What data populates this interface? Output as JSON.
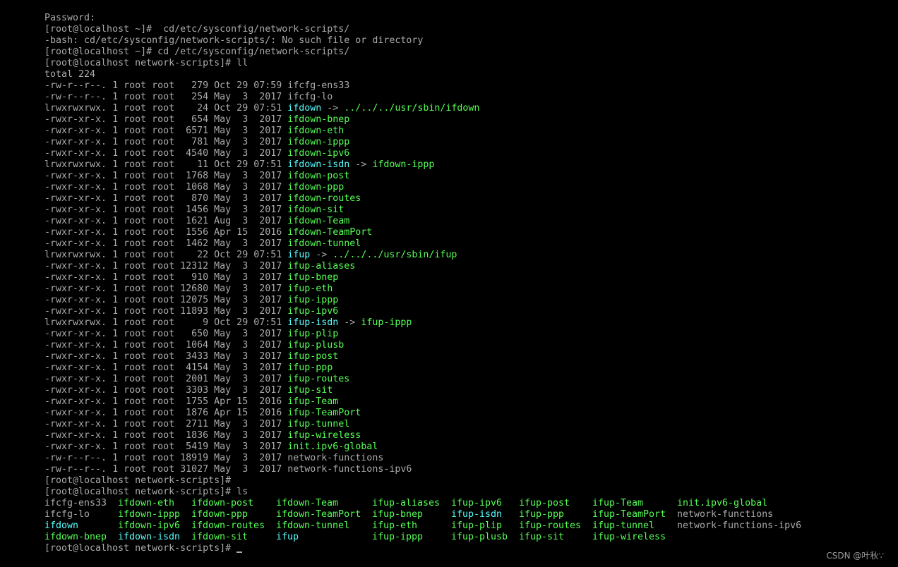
{
  "colors": {
    "background": "#000000",
    "plain": "#aaaaaa",
    "exec": "#55ff55",
    "link": "#55ffff"
  },
  "preamble": [
    "Password:",
    "[root@localhost ~]#  cd/etc/sysconfig/network-scripts/",
    "-bash: cd/etc/sysconfig/network-scripts/: No such file or directory",
    "[root@localhost ~]# cd /etc/sysconfig/network-scripts/",
    "[root@localhost network-scripts]# ll",
    "total 224"
  ],
  "ll_rows": [
    {
      "meta": "-rw-r--r--. 1 root root   279 Oct 29 07:59 ",
      "name": "ifcfg-ens33",
      "kind": "plain"
    },
    {
      "meta": "-rw-r--r--. 1 root root   254 May  3  2017 ",
      "name": "ifcfg-lo",
      "kind": "plain"
    },
    {
      "meta": "lrwxrwxrwx. 1 root root    24 Oct 29 07:51 ",
      "name": "ifdown",
      "kind": "link",
      "target": "../../../usr/sbin/ifdown"
    },
    {
      "meta": "-rwxr-xr-x. 1 root root   654 May  3  2017 ",
      "name": "ifdown-bnep",
      "kind": "exec"
    },
    {
      "meta": "-rwxr-xr-x. 1 root root  6571 May  3  2017 ",
      "name": "ifdown-eth",
      "kind": "exec"
    },
    {
      "meta": "-rwxr-xr-x. 1 root root   781 May  3  2017 ",
      "name": "ifdown-ippp",
      "kind": "exec"
    },
    {
      "meta": "-rwxr-xr-x. 1 root root  4540 May  3  2017 ",
      "name": "ifdown-ipv6",
      "kind": "exec"
    },
    {
      "meta": "lrwxrwxrwx. 1 root root    11 Oct 29 07:51 ",
      "name": "ifdown-isdn",
      "kind": "link",
      "target": "ifdown-ippp"
    },
    {
      "meta": "-rwxr-xr-x. 1 root root  1768 May  3  2017 ",
      "name": "ifdown-post",
      "kind": "exec"
    },
    {
      "meta": "-rwxr-xr-x. 1 root root  1068 May  3  2017 ",
      "name": "ifdown-ppp",
      "kind": "exec"
    },
    {
      "meta": "-rwxr-xr-x. 1 root root   870 May  3  2017 ",
      "name": "ifdown-routes",
      "kind": "exec"
    },
    {
      "meta": "-rwxr-xr-x. 1 root root  1456 May  3  2017 ",
      "name": "ifdown-sit",
      "kind": "exec"
    },
    {
      "meta": "-rwxr-xr-x. 1 root root  1621 Aug  3  2017 ",
      "name": "ifdown-Team",
      "kind": "exec"
    },
    {
      "meta": "-rwxr-xr-x. 1 root root  1556 Apr 15  2016 ",
      "name": "ifdown-TeamPort",
      "kind": "exec"
    },
    {
      "meta": "-rwxr-xr-x. 1 root root  1462 May  3  2017 ",
      "name": "ifdown-tunnel",
      "kind": "exec"
    },
    {
      "meta": "lrwxrwxrwx. 1 root root    22 Oct 29 07:51 ",
      "name": "ifup",
      "kind": "link",
      "target": "../../../usr/sbin/ifup"
    },
    {
      "meta": "-rwxr-xr-x. 1 root root 12312 May  3  2017 ",
      "name": "ifup-aliases",
      "kind": "exec"
    },
    {
      "meta": "-rwxr-xr-x. 1 root root   910 May  3  2017 ",
      "name": "ifup-bnep",
      "kind": "exec"
    },
    {
      "meta": "-rwxr-xr-x. 1 root root 12680 May  3  2017 ",
      "name": "ifup-eth",
      "kind": "exec"
    },
    {
      "meta": "-rwxr-xr-x. 1 root root 12075 May  3  2017 ",
      "name": "ifup-ippp",
      "kind": "exec"
    },
    {
      "meta": "-rwxr-xr-x. 1 root root 11893 May  3  2017 ",
      "name": "ifup-ipv6",
      "kind": "exec"
    },
    {
      "meta": "lrwxrwxrwx. 1 root root     9 Oct 29 07:51 ",
      "name": "ifup-isdn",
      "kind": "link",
      "target": "ifup-ippp"
    },
    {
      "meta": "-rwxr-xr-x. 1 root root   650 May  3  2017 ",
      "name": "ifup-plip",
      "kind": "exec"
    },
    {
      "meta": "-rwxr-xr-x. 1 root root  1064 May  3  2017 ",
      "name": "ifup-plusb",
      "kind": "exec"
    },
    {
      "meta": "-rwxr-xr-x. 1 root root  3433 May  3  2017 ",
      "name": "ifup-post",
      "kind": "exec"
    },
    {
      "meta": "-rwxr-xr-x. 1 root root  4154 May  3  2017 ",
      "name": "ifup-ppp",
      "kind": "exec"
    },
    {
      "meta": "-rwxr-xr-x. 1 root root  2001 May  3  2017 ",
      "name": "ifup-routes",
      "kind": "exec"
    },
    {
      "meta": "-rwxr-xr-x. 1 root root  3303 May  3  2017 ",
      "name": "ifup-sit",
      "kind": "exec"
    },
    {
      "meta": "-rwxr-xr-x. 1 root root  1755 Apr 15  2016 ",
      "name": "ifup-Team",
      "kind": "exec"
    },
    {
      "meta": "-rwxr-xr-x. 1 root root  1876 Apr 15  2016 ",
      "name": "ifup-TeamPort",
      "kind": "exec"
    },
    {
      "meta": "-rwxr-xr-x. 1 root root  2711 May  3  2017 ",
      "name": "ifup-tunnel",
      "kind": "exec"
    },
    {
      "meta": "-rwxr-xr-x. 1 root root  1836 May  3  2017 ",
      "name": "ifup-wireless",
      "kind": "exec"
    },
    {
      "meta": "-rwxr-xr-x. 1 root root  5419 May  3  2017 ",
      "name": "init.ipv6-global",
      "kind": "exec"
    },
    {
      "meta": "-rw-r--r--. 1 root root 18919 May  3  2017 ",
      "name": "network-functions",
      "kind": "plain"
    },
    {
      "meta": "-rw-r--r--. 1 root root 31027 May  3  2017 ",
      "name": "network-functions-ipv6",
      "kind": "plain"
    }
  ],
  "after_ll": [
    "[root@localhost network-scripts]#",
    "[root@localhost network-scripts]# ls"
  ],
  "ls_rows": [
    [
      {
        "name": "ifcfg-ens33",
        "kind": "plain"
      },
      {
        "name": "ifdown-eth",
        "kind": "exec"
      },
      {
        "name": "ifdown-post",
        "kind": "exec"
      },
      {
        "name": "ifdown-Team",
        "kind": "exec"
      },
      {
        "name": "ifup-aliases",
        "kind": "exec"
      },
      {
        "name": "ifup-ipv6",
        "kind": "exec"
      },
      {
        "name": "ifup-post",
        "kind": "exec"
      },
      {
        "name": "ifup-Team",
        "kind": "exec"
      },
      {
        "name": "init.ipv6-global",
        "kind": "exec"
      }
    ],
    [
      {
        "name": "ifcfg-lo",
        "kind": "plain"
      },
      {
        "name": "ifdown-ippp",
        "kind": "exec"
      },
      {
        "name": "ifdown-ppp",
        "kind": "exec"
      },
      {
        "name": "ifdown-TeamPort",
        "kind": "exec"
      },
      {
        "name": "ifup-bnep",
        "kind": "exec"
      },
      {
        "name": "ifup-isdn",
        "kind": "link"
      },
      {
        "name": "ifup-ppp",
        "kind": "exec"
      },
      {
        "name": "ifup-TeamPort",
        "kind": "exec"
      },
      {
        "name": "network-functions",
        "kind": "plain"
      }
    ],
    [
      {
        "name": "ifdown",
        "kind": "link"
      },
      {
        "name": "ifdown-ipv6",
        "kind": "exec"
      },
      {
        "name": "ifdown-routes",
        "kind": "exec"
      },
      {
        "name": "ifdown-tunnel",
        "kind": "exec"
      },
      {
        "name": "ifup-eth",
        "kind": "exec"
      },
      {
        "name": "ifup-plip",
        "kind": "exec"
      },
      {
        "name": "ifup-routes",
        "kind": "exec"
      },
      {
        "name": "ifup-tunnel",
        "kind": "exec"
      },
      {
        "name": "network-functions-ipv6",
        "kind": "plain"
      }
    ],
    [
      {
        "name": "ifdown-bnep",
        "kind": "exec"
      },
      {
        "name": "ifdown-isdn",
        "kind": "link"
      },
      {
        "name": "ifdown-sit",
        "kind": "exec"
      },
      {
        "name": "ifup",
        "kind": "link"
      },
      {
        "name": "ifup-ippp",
        "kind": "exec"
      },
      {
        "name": "ifup-plusb",
        "kind": "exec"
      },
      {
        "name": "ifup-sit",
        "kind": "exec"
      },
      {
        "name": "ifup-wireless",
        "kind": "exec"
      }
    ]
  ],
  "prompt": "[root@localhost network-scripts]# ",
  "arrow": " -> ",
  "watermark": "CSDN @叶秋∵"
}
